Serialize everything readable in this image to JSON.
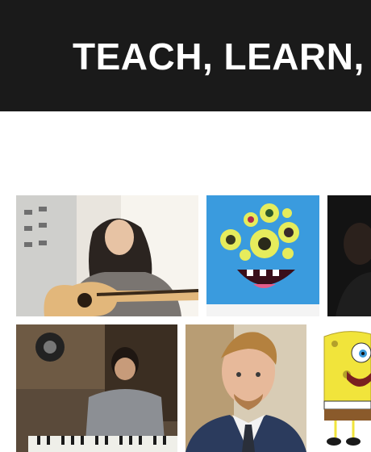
{
  "banner": {
    "title": "TEACH, LEARN,"
  },
  "gallery": {
    "items": [
      {
        "name": "photo-girl-guitar",
        "subject": "guitar"
      },
      {
        "name": "photo-blue-monster",
        "subject": "monster"
      },
      {
        "name": "photo-dark-portrait",
        "subject": "portrait"
      },
      {
        "name": "photo-keyboard-player",
        "subject": "keyboard"
      },
      {
        "name": "photo-man-suit",
        "subject": "man"
      },
      {
        "name": "photo-spongebob",
        "subject": "cartoon"
      }
    ]
  }
}
